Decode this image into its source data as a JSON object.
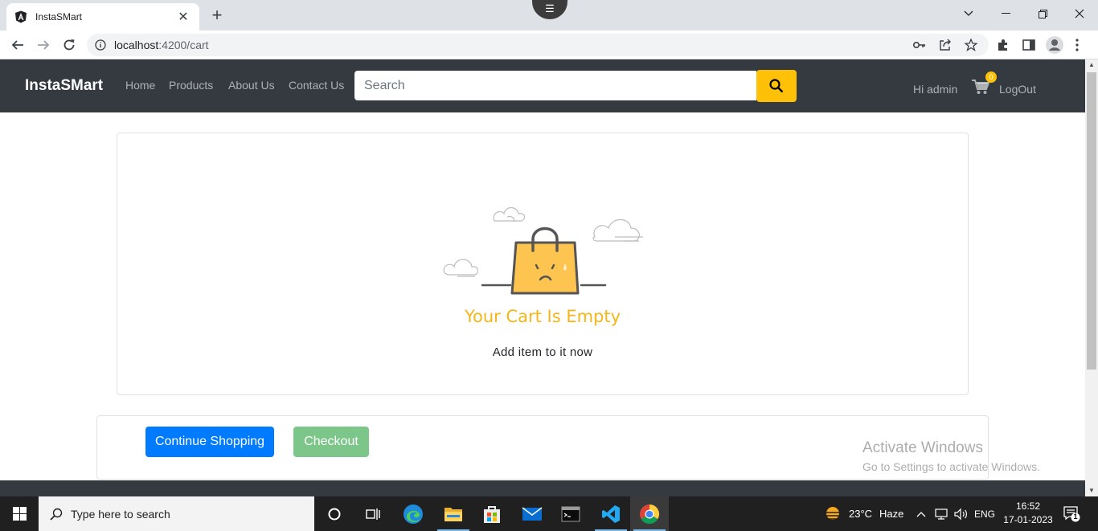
{
  "browser": {
    "tab_title": "InstaSMart",
    "url_host": "localhost",
    "url_path": ":4200/cart"
  },
  "navbar": {
    "brand": "InstaSMart",
    "links": [
      "Home",
      "Products",
      "About Us",
      "Contact Us"
    ],
    "search_placeholder": "Search",
    "greeting": "Hi admin",
    "cart_count": "0",
    "logout": "LogOut"
  },
  "cart": {
    "empty_title": "Your Cart Is Empty",
    "empty_subtitle": "Add item to it now",
    "continue_label": "Continue Shopping",
    "checkout_label": "Checkout"
  },
  "watermark": {
    "line1": "Activate Windows",
    "line2": "Go to Settings to activate Windows."
  },
  "taskbar": {
    "search_placeholder": "Type here to search",
    "weather_temp": "23°C",
    "weather_desc": "Haze",
    "language": "ENG",
    "time": "16:52",
    "date": "17-01-2023",
    "notification_count": "1"
  },
  "colors": {
    "navbar_bg": "#343a40",
    "accent_yellow": "#ffc107",
    "primary_blue": "#007bff",
    "checkout_green": "#7dc68a",
    "empty_title": "#f6b519"
  }
}
